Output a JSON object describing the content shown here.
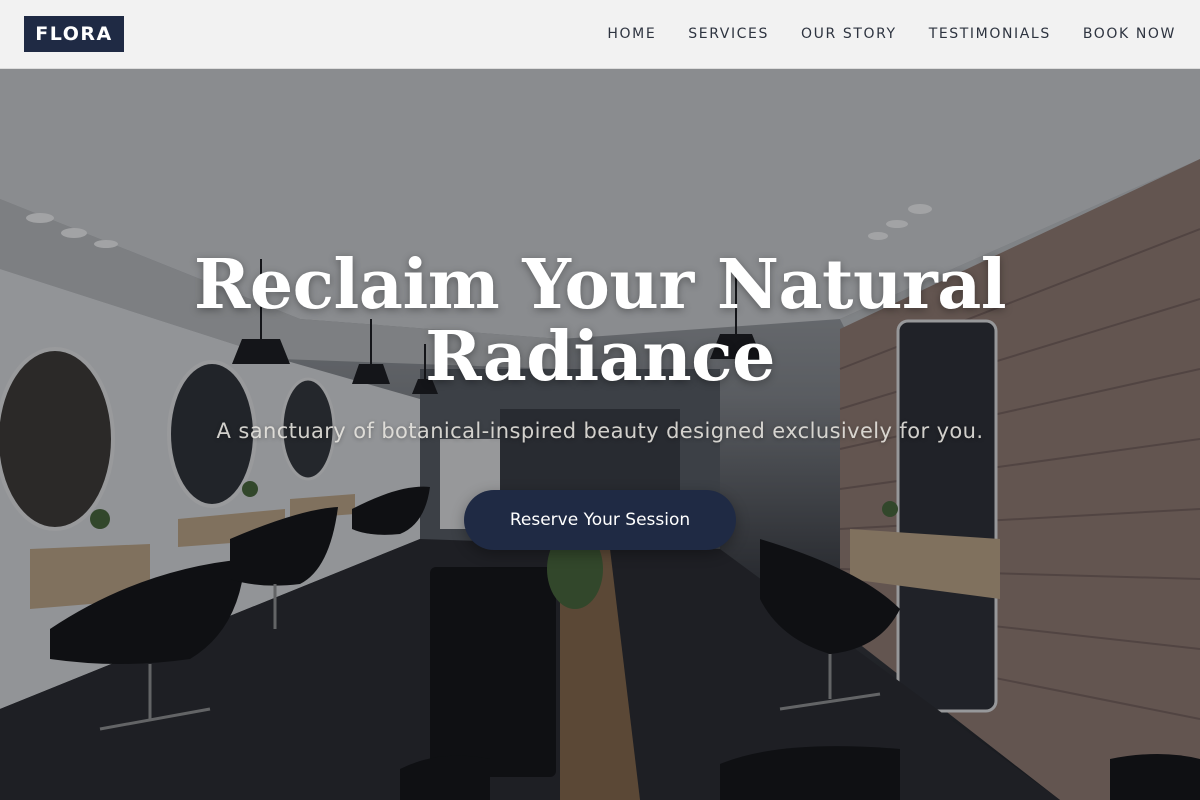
{
  "brand": {
    "logo_text": "FLORA",
    "primary_color": "#1f2a44"
  },
  "nav": {
    "items": [
      {
        "label": "HOME"
      },
      {
        "label": "SERVICES"
      },
      {
        "label": "OUR STORY"
      },
      {
        "label": "TESTIMONIALS"
      },
      {
        "label": "BOOK NOW"
      }
    ]
  },
  "hero": {
    "title_line1": "Reclaim Your Natural",
    "title_line2": "Radiance",
    "subtitle": "A sanctuary of botanical-inspired beauty designed exclusively for you.",
    "cta_label": "Reserve Your Session",
    "background_image": "salon-interior-photo"
  }
}
